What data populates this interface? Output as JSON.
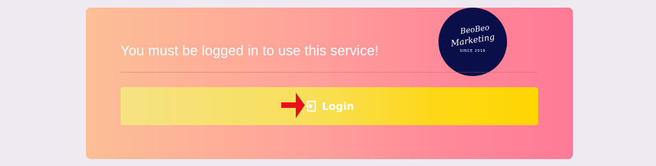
{
  "message": "You must be logged in to use this service!",
  "logo": {
    "line1": "BeoBeo",
    "line2": "Marketing",
    "line3": "SINCE 2016"
  },
  "login_button": {
    "label": "Login",
    "icon": "sign-in-icon"
  },
  "annotation": {
    "icon": "red-arrow-icon",
    "color": "#e8101a"
  },
  "colors": {
    "background": "#efeaf2",
    "card_gradient_start": "#fcbf95",
    "card_gradient_end": "#ff7a96",
    "button_gradient_start": "#f6e283",
    "button_gradient_end": "#ffd600",
    "logo_background": "#0b0f49"
  }
}
